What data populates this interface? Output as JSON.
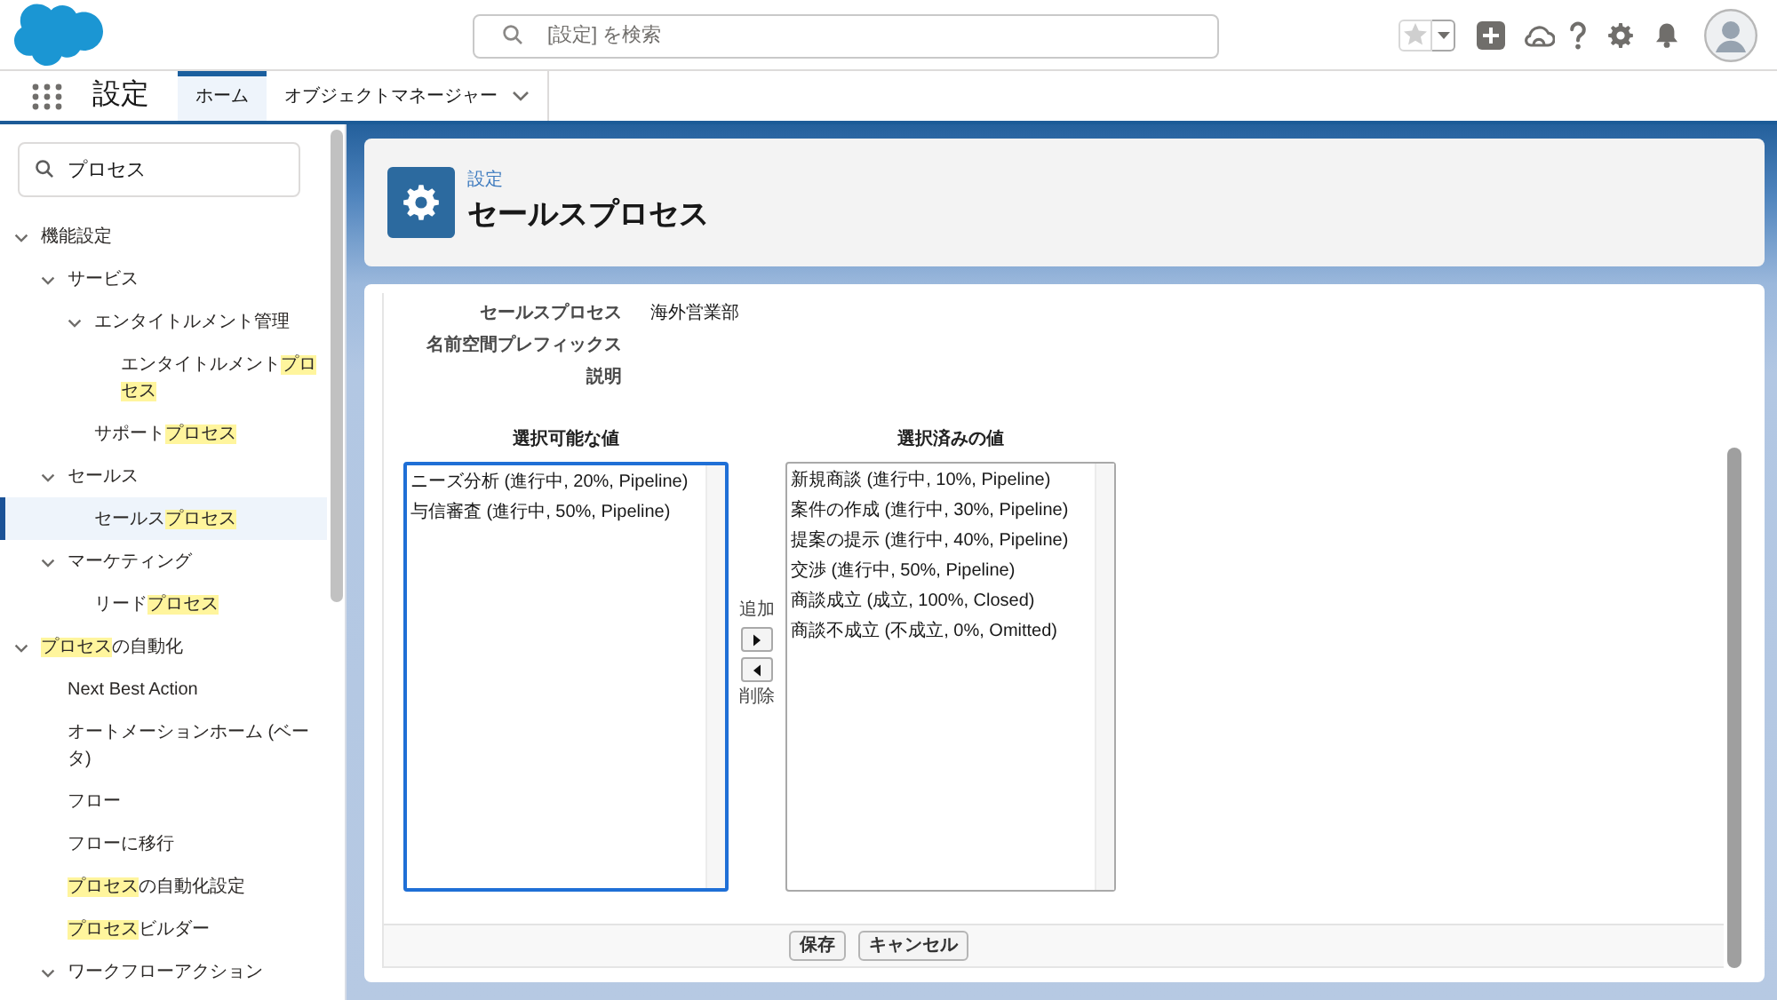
{
  "header": {
    "search": {
      "placeholder": "[設定] を検索"
    }
  },
  "nav": {
    "app_name": "設定",
    "tabs": [
      {
        "label": "ホーム",
        "selected": true,
        "menu": false
      },
      {
        "label": "オブジェクトマネージャー",
        "selected": false,
        "menu": true
      }
    ]
  },
  "sidebar": {
    "search": {
      "value": "プロセス"
    },
    "tree": [
      {
        "kind": "group",
        "parts": [
          {
            "text": "機能設定",
            "highlight": false
          }
        ],
        "expanded": true,
        "selected": false,
        "children": [
          {
            "kind": "group",
            "parts": [
              {
                "text": "サービス",
                "highlight": false
              }
            ],
            "expanded": true,
            "selected": false,
            "children": [
              {
                "kind": "group",
                "parts": [
                  {
                    "text": "エンタイトルメント管理",
                    "highlight": false
                  }
                ],
                "expanded": true,
                "selected": false,
                "children": [
                  {
                    "kind": "leaf",
                    "parts": [
                      {
                        "text": "エンタイトルメント",
                        "highlight": false
                      },
                      {
                        "text": "プロセス",
                        "highlight": true
                      }
                    ],
                    "selected": false
                  }
                ]
              },
              {
                "kind": "leaf",
                "parts": [
                  {
                    "text": "サポート",
                    "highlight": false
                  },
                  {
                    "text": "プロセス",
                    "highlight": true
                  }
                ],
                "selected": false
              }
            ]
          },
          {
            "kind": "group",
            "parts": [
              {
                "text": "セールス",
                "highlight": false
              }
            ],
            "expanded": true,
            "selected": false,
            "children": [
              {
                "kind": "leaf",
                "parts": [
                  {
                    "text": "セールス",
                    "highlight": false
                  },
                  {
                    "text": "プロセス",
                    "highlight": true
                  }
                ],
                "selected": true
              }
            ]
          },
          {
            "kind": "group",
            "parts": [
              {
                "text": "マーケティング",
                "highlight": false
              }
            ],
            "expanded": true,
            "selected": false,
            "children": [
              {
                "kind": "leaf",
                "parts": [
                  {
                    "text": "リード",
                    "highlight": false
                  },
                  {
                    "text": "プロセス",
                    "highlight": true
                  }
                ],
                "selected": false
              }
            ]
          }
        ]
      },
      {
        "kind": "group",
        "parts": [
          {
            "text": "プロセス",
            "highlight": true
          },
          {
            "text": "の自動化",
            "highlight": false
          }
        ],
        "expanded": true,
        "selected": false,
        "children": [
          {
            "kind": "leaf",
            "parts": [
              {
                "text": "Next Best Action",
                "highlight": false
              }
            ],
            "selected": false
          },
          {
            "kind": "leaf",
            "parts": [
              {
                "text": "オートメーションホーム (ベータ)",
                "highlight": false
              }
            ],
            "selected": false
          },
          {
            "kind": "leaf",
            "parts": [
              {
                "text": "フロー",
                "highlight": false
              }
            ],
            "selected": false
          },
          {
            "kind": "leaf",
            "parts": [
              {
                "text": "フローに移行",
                "highlight": false
              }
            ],
            "selected": false
          },
          {
            "kind": "leaf",
            "parts": [
              {
                "text": "プロセス",
                "highlight": true
              },
              {
                "text": "の自動化設定",
                "highlight": false
              }
            ],
            "selected": false
          },
          {
            "kind": "leaf",
            "parts": [
              {
                "text": "プロセス",
                "highlight": true
              },
              {
                "text": "ビルダー",
                "highlight": false
              }
            ],
            "selected": false
          },
          {
            "kind": "group",
            "parts": [
              {
                "text": "ワークフローアクション",
                "highlight": false
              }
            ],
            "expanded": true,
            "selected": false
          }
        ]
      }
    ]
  },
  "page_header": {
    "breadcrumb": "設定",
    "title": "セールスプロセス"
  },
  "details": {
    "fields": [
      {
        "label": "セールスプロセス",
        "value": "海外営業部"
      },
      {
        "label": "名前空間プレフィックス"
      },
      {
        "label": "説明"
      }
    ]
  },
  "picklist": {
    "available": {
      "heading": "選択可能な値",
      "focused": true,
      "options": [
        {
          "label": "ニーズ分析 (進行中, 20%, Pipeline)",
          "selected": false
        },
        {
          "label": "与信審査 (進行中, 50%, Pipeline)",
          "selected": false
        }
      ]
    },
    "chosen": {
      "heading": "選択済みの値",
      "focused": false,
      "options": [
        {
          "label": "新規商談 (進行中, 10%, Pipeline)",
          "selected": false
        },
        {
          "label": "案件の作成 (進行中, 30%, Pipeline)",
          "selected": false
        },
        {
          "label": "提案の提示 (進行中, 40%, Pipeline)",
          "selected": false
        },
        {
          "label": "交渉 (進行中, 50%, Pipeline)",
          "selected": false
        },
        {
          "label": "商談成立 (成立, 100%, Closed)",
          "selected": false
        },
        {
          "label": "商談不成立 (不成立, 0%, Omitted)",
          "selected": false
        }
      ]
    },
    "add_label": "追加",
    "remove_label": "削除"
  },
  "buttons": [
    {
      "label": "保存"
    },
    {
      "label": "キャンセル"
    }
  ]
}
